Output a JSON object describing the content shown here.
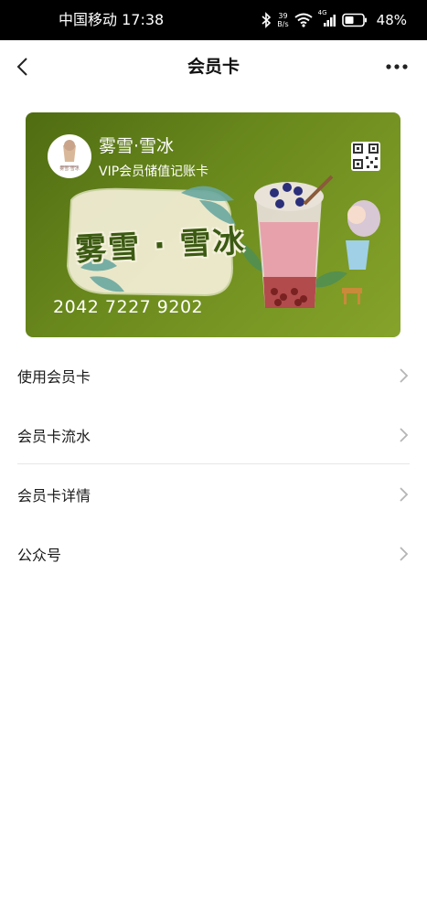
{
  "status_bar": {
    "carrier_time": "中国移动 17:38",
    "net_speed_value": "39",
    "net_speed_unit": "B/s",
    "signal_label": "4G",
    "battery": "48%"
  },
  "nav": {
    "title": "会员卡",
    "back_icon": "back-chevron-icon",
    "more_icon": "more-dots-icon"
  },
  "card": {
    "brand_name": "雾雪·雪冰",
    "card_type": "VIP会员储值记账卡",
    "logo_text": "雾雪·雪冰",
    "art_title": "雾雪 · 雪冰",
    "number": "2042 7227 9202",
    "colors": {
      "start": "#4f6c12",
      "end": "#86a42a"
    }
  },
  "menu": {
    "items": [
      {
        "label": "使用会员卡"
      },
      {
        "label": "会员卡流水"
      },
      {
        "label": "会员卡详情"
      },
      {
        "label": "公众号"
      }
    ]
  }
}
